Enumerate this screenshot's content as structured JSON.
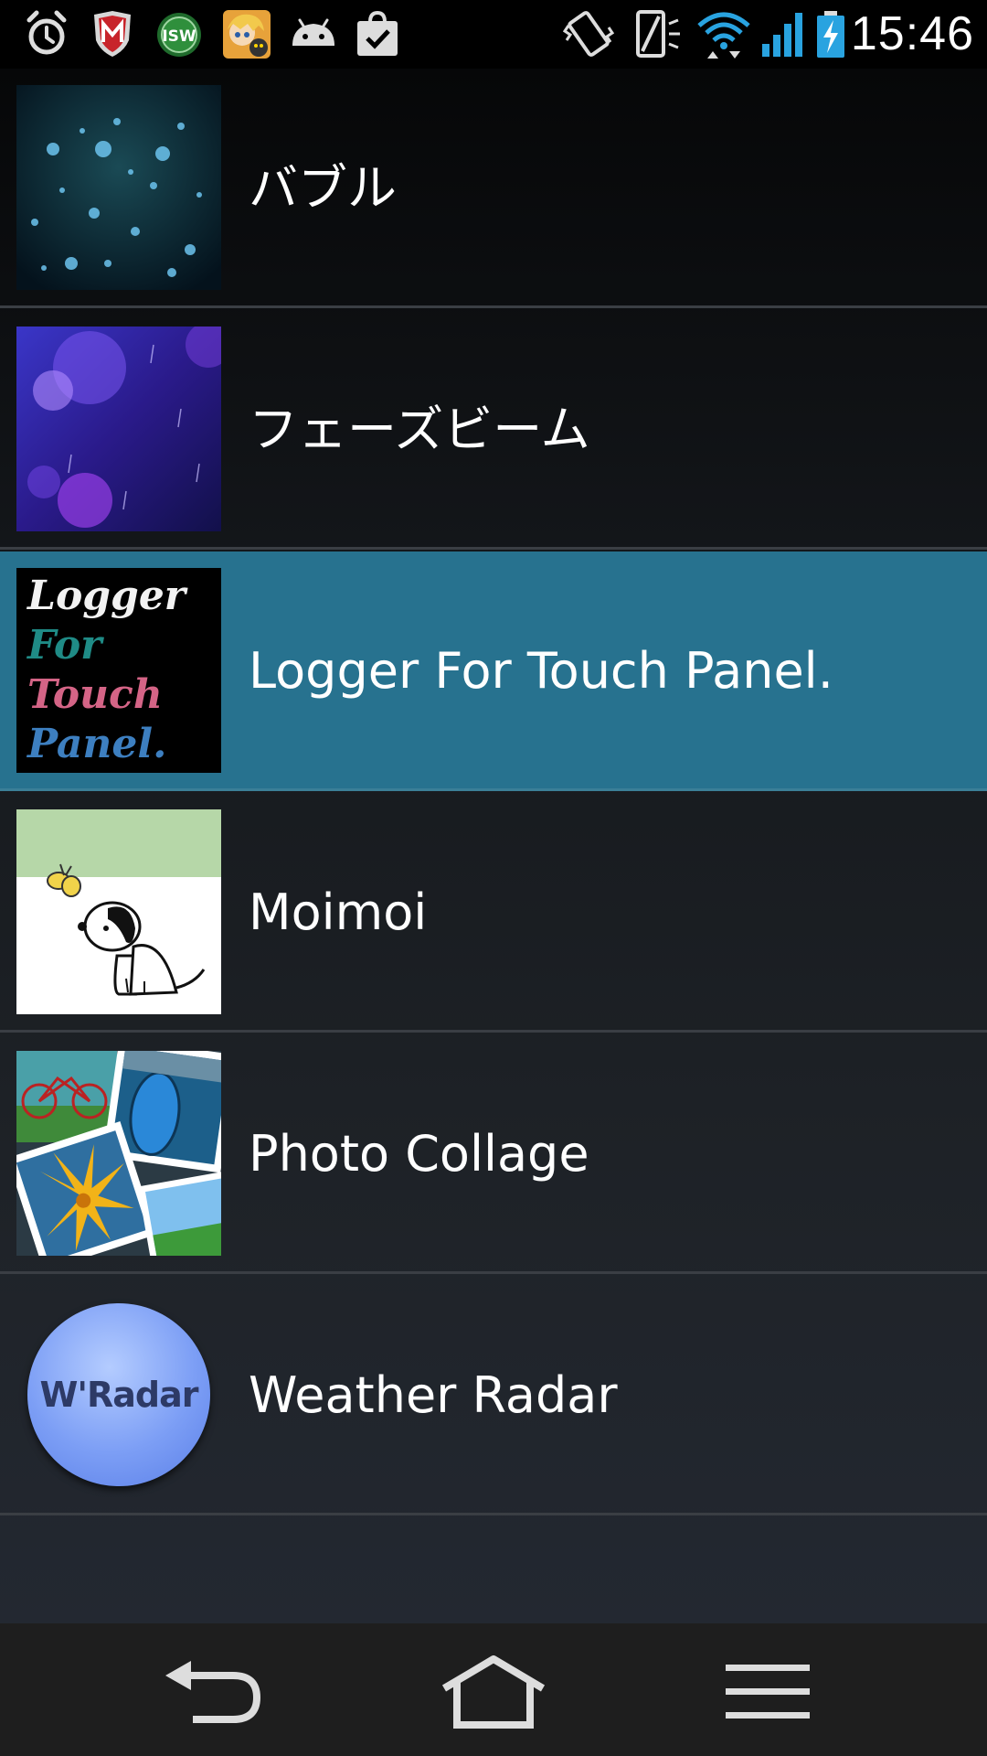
{
  "status_bar": {
    "time": "15:46",
    "icons_left": [
      "alarm-icon",
      "mcafee-shield-icon",
      "isw-app-icon",
      "anime-app-icon",
      "android-icon",
      "shopping-bag-icon"
    ],
    "icons_right": [
      "vibrate-icon",
      "nfc-phone-icon",
      "wifi-icon",
      "signal-icon",
      "battery-charging-icon"
    ]
  },
  "list": {
    "items": [
      {
        "label": "バブル",
        "thumbnail": "bubbles-wallpaper",
        "selected": false
      },
      {
        "label": "フェーズビーム",
        "thumbnail": "phase-beam-wallpaper",
        "selected": false
      },
      {
        "label": "Logger For Touch Panel.",
        "thumbnail": "logger-logo",
        "selected": true,
        "thumb_text": [
          "Logger",
          "For",
          "Touch",
          "Panel."
        ]
      },
      {
        "label": "Moimoi",
        "thumbnail": "dog-illustration",
        "selected": false
      },
      {
        "label": "Photo Collage",
        "thumbnail": "photo-collage-image",
        "selected": false
      },
      {
        "label": "Weather Radar",
        "thumbnail": "weather-radar-logo",
        "selected": false,
        "thumb_text": "W'Radar"
      }
    ]
  },
  "nav_bar": {
    "buttons": [
      "back-icon",
      "home-icon",
      "menu-icon"
    ]
  },
  "colors": {
    "selected_row": "#27728f",
    "divider": "#3a3e44",
    "nav_background": "#1e1e1e",
    "status_accent": "#29a3e0"
  }
}
